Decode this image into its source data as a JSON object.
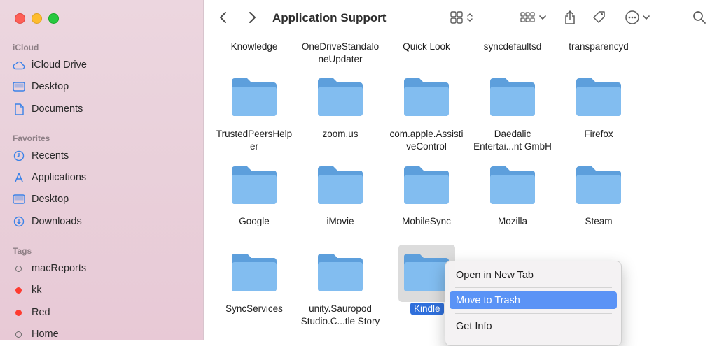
{
  "window": {
    "title": "Application Support"
  },
  "sidebar": {
    "sections": [
      {
        "title": "iCloud",
        "items": [
          {
            "label": "iCloud Drive",
            "icon": "cloud-icon"
          },
          {
            "label": "Desktop",
            "icon": "desktop-icon"
          },
          {
            "label": "Documents",
            "icon": "document-icon"
          }
        ]
      },
      {
        "title": "Favorites",
        "items": [
          {
            "label": "Recents",
            "icon": "clock-icon"
          },
          {
            "label": "Applications",
            "icon": "applications-icon"
          },
          {
            "label": "Desktop",
            "icon": "desktop-icon"
          },
          {
            "label": "Downloads",
            "icon": "download-icon"
          }
        ]
      },
      {
        "title": "Tags",
        "items": [
          {
            "label": "macReports",
            "icon": "tag-hollow-icon"
          },
          {
            "label": "kk",
            "icon": "tag-red-icon",
            "color": "#fe3b30"
          },
          {
            "label": "Red",
            "icon": "tag-red-icon",
            "color": "#fe3b30"
          },
          {
            "label": "Home",
            "icon": "tag-hollow-icon"
          }
        ]
      }
    ]
  },
  "grid": {
    "top_row_labels": [
      [
        "Knowledge"
      ],
      [
        "OneDriveStandalo",
        "neUpdater"
      ],
      [
        "Quick Look"
      ],
      [
        "syncdefaultsd"
      ],
      [
        "transparencyd"
      ]
    ],
    "rows": [
      [
        {
          "label": [
            "TrustedPeersHelp",
            "er"
          ]
        },
        {
          "label": [
            "zoom.us"
          ]
        },
        {
          "label": [
            "com.apple.Assisti",
            "veControl"
          ]
        },
        {
          "label": [
            "Daedalic",
            "Entertai...nt GmbH"
          ]
        },
        {
          "label": [
            "Firefox"
          ]
        }
      ],
      [
        {
          "label": [
            "Google"
          ]
        },
        {
          "label": [
            "iMovie"
          ]
        },
        {
          "label": [
            "MobileSync"
          ]
        },
        {
          "label": [
            "Mozilla"
          ]
        },
        {
          "label": [
            "Steam"
          ]
        }
      ],
      [
        {
          "label": [
            "SyncServices"
          ]
        },
        {
          "label": [
            "unity.Sauropod",
            "Studio.C...tle Story"
          ]
        },
        {
          "label": [
            "Kindle"
          ],
          "selected": true
        }
      ]
    ],
    "folder_color": "#7ab8ec"
  },
  "context_menu": {
    "items": [
      {
        "label": "Open in New Tab",
        "active": false
      },
      {
        "label": "Move to Trash",
        "active": true
      },
      {
        "label": "Get Info",
        "active": false
      }
    ],
    "accent": "#5a93f6"
  },
  "colors": {
    "selection": "#2f6fdb",
    "sidebar_bg": "#ecd6df"
  }
}
